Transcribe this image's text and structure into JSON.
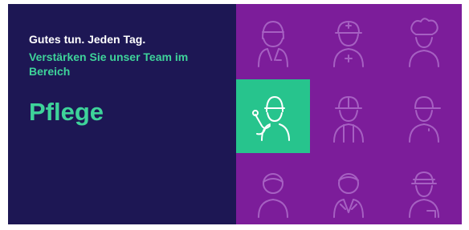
{
  "banner": {
    "headline": "Gutes tun. Jeden Tag.",
    "subline": "Verstärken Sie unser Team im Bereich",
    "role": "Pflege"
  },
  "colors": {
    "left_background": "#1d1754",
    "right_background": "#7c1d9a",
    "accent_green": "#3ed39a",
    "highlight_tile": "#27c48d",
    "icon_outline": "#a660c2"
  },
  "icons": [
    "doctor-icon",
    "paramedic-icon",
    "chef-icon",
    "nurse-stethoscope-icon",
    "construction-worker-icon",
    "cap-worker-icon",
    "person-icon",
    "suit-person-icon",
    "postal-worker-icon"
  ],
  "highlighted_icon": "nurse-stethoscope-icon"
}
